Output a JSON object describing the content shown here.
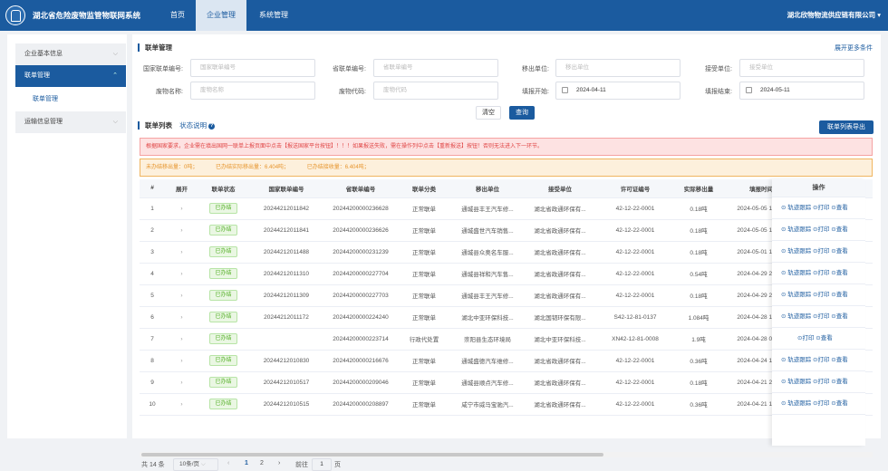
{
  "header": {
    "title": "湖北省危险废物监管物联网系统",
    "nav": [
      "首页",
      "企业管理",
      "系统管理"
    ],
    "company": "湖北欣物物流供应链有限公司 ▾"
  },
  "sidebar": {
    "items": [
      {
        "label": "企业基本信息"
      },
      {
        "label": "联单管理"
      },
      {
        "label": "运输信息管理"
      }
    ],
    "sub_item": "联单管理"
  },
  "filter": {
    "section_title": "联单管理",
    "expand_link": "展开更多条件",
    "fields": [
      {
        "label": "国家联单编号:",
        "placeholder": "国家联单编号"
      },
      {
        "label": "省联单编号:",
        "placeholder": "省联单编号"
      },
      {
        "label": "移出单位:",
        "placeholder": "移出单位"
      },
      {
        "label": "接受单位:",
        "placeholder": "接受单位"
      },
      {
        "label": "废物名称:",
        "placeholder": "废物名称"
      },
      {
        "label": "废物代码:",
        "placeholder": "废物代码"
      },
      {
        "label": "填报开始:",
        "value": "2024-04-11"
      },
      {
        "label": "填报结束:",
        "value": "2024-05-11"
      }
    ],
    "clear_button": "清空",
    "search_button": "查询"
  },
  "list": {
    "title": "联单列表",
    "status_link": "状态说明",
    "export_button": "联单列表导出",
    "alert_red": "根据国家要求，企业需在填出国网一联单上报页面中点击【报送国家平台按钮】！！！如果报送失败，需在操作列中点击【重新报送】按钮！否则无法进入下一环节。",
    "alert_orange": [
      "未办结移出量：0吨；",
      "已办结实际移出量：6.404吨；",
      "已办结接收量：6.404吨；"
    ],
    "columns": [
      "#",
      "展开",
      "联单状态",
      "国家联单编号",
      "省联单编号",
      "联单分类",
      "移出单位",
      "接受单位",
      "许可证编号",
      "实际移出量",
      "填报时间"
    ],
    "ops_header": "操作",
    "rows": [
      {
        "no": "1",
        "expand": "›",
        "status": "已办结",
        "national": "20244212011842",
        "province": "20244200000236628",
        "type": "正常联单",
        "from": "通城县丰王汽车修...",
        "to": "湖北省政通环保有...",
        "license": "42-12-22-0001",
        "amount": "0.18吨",
        "time": "2024-05-05 17:41:",
        "ops": "⊙ 轨迹跟踪 ⊙打印 ⊙查看"
      },
      {
        "no": "2",
        "expand": "›",
        "status": "已办结",
        "national": "20244212011841",
        "province": "20244200000236626",
        "type": "正常联单",
        "from": "通城盛世汽车销售...",
        "to": "湖北省政通环保有...",
        "license": "42-12-22-0001",
        "amount": "0.18吨",
        "time": "2024-05-05 17:39:",
        "ops": "⊙ 轨迹跟踪 ⊙打印 ⊙查看"
      },
      {
        "no": "3",
        "expand": "›",
        "status": "已办结",
        "national": "20244212011488",
        "province": "20244200000231239",
        "type": "正常联单",
        "from": "通城县众奥名车服...",
        "to": "湖北省政通环保有...",
        "license": "42-12-22-0001",
        "amount": "0.18吨",
        "time": "2024-05-01 15:21:",
        "ops": "⊙ 轨迹跟踪 ⊙打印 ⊙查看"
      },
      {
        "no": "4",
        "expand": "›",
        "status": "已办结",
        "national": "20244212011310",
        "province": "20244200000227704",
        "type": "正常联单",
        "from": "通城县祥和汽车售...",
        "to": "湖北省政通环保有...",
        "license": "42-12-22-0001",
        "amount": "0.54吨",
        "time": "2024-04-29 22:38:",
        "ops": "⊙ 轨迹跟踪 ⊙打印 ⊙查看"
      },
      {
        "no": "5",
        "expand": "›",
        "status": "已办结",
        "national": "20244212011309",
        "province": "20244200000227703",
        "type": "正常联单",
        "from": "通城县丰王汽车修...",
        "to": "湖北省政通环保有...",
        "license": "42-12-22-0001",
        "amount": "0.18吨",
        "time": "2024-04-29 22:36:",
        "ops": "⊙ 轨迹跟踪 ⊙打印 ⊙查看"
      },
      {
        "no": "6",
        "expand": "›",
        "status": "已办结",
        "national": "20244212011172",
        "province": "20244200000224240",
        "type": "正常联单",
        "from": "湖北中亚环保科技...",
        "to": "湖北国韧环保有限...",
        "license": "S42-12-81-0137",
        "amount": "1.084吨",
        "time": "2024-04-28 13:19:",
        "ops": "⊙ 轨迹跟踪 ⊙打印 ⊙查看"
      },
      {
        "no": "7",
        "expand": "›",
        "status": "已办结",
        "national": "",
        "province": "20244200000223714",
        "type": "行政代处置",
        "from": "崇阳县生态环境局",
        "to": "湖北中亚环保科技...",
        "license": "XN42-12-81-0008",
        "amount": "1.9吨",
        "time": "2024-04-28 09:58:",
        "ops": "⊙打印 ⊙查看"
      },
      {
        "no": "8",
        "expand": "›",
        "status": "已办结",
        "national": "20244212010830",
        "province": "20244200000216676",
        "type": "正常联单",
        "from": "通城盛德汽车维修...",
        "to": "湖北省政通环保有...",
        "license": "42-12-22-0001",
        "amount": "0.36吨",
        "time": "2024-04-24 17:46:",
        "ops": "⊙ 轨迹跟踪 ⊙打印 ⊙查看"
      },
      {
        "no": "9",
        "expand": "›",
        "status": "已办结",
        "national": "20244212010517",
        "province": "20244200000209046",
        "type": "正常联单",
        "from": "通城县顺点汽车修...",
        "to": "湖北省政通环保有...",
        "license": "42-12-22-0001",
        "amount": "0.18吨",
        "time": "2024-04-21 21:18:",
        "ops": "⊙ 轨迹跟踪 ⊙打印 ⊙查看"
      },
      {
        "no": "10",
        "expand": "›",
        "status": "已办结",
        "national": "20244212010515",
        "province": "20244200000208897",
        "type": "正常联单",
        "from": "咸宁市威马宝驰汽...",
        "to": "湖北省政通环保有...",
        "license": "42-12-22-0001",
        "amount": "0.36吨",
        "time": "2024-04-21 17:14:",
        "ops": "⊙ 轨迹跟踪 ⊙打印 ⊙查看"
      }
    ]
  },
  "pagination": {
    "total": "共 14 条",
    "page_size": "10条/页",
    "prev": "‹",
    "pages": [
      "1",
      "2"
    ],
    "next": "›",
    "goto_label": "前往",
    "goto_value": "1",
    "page_suffix": "页"
  },
  "colors": {
    "primary": "#1b5b9f",
    "success": "#55b028",
    "danger": "#e04545",
    "warning": "#e6952d"
  }
}
